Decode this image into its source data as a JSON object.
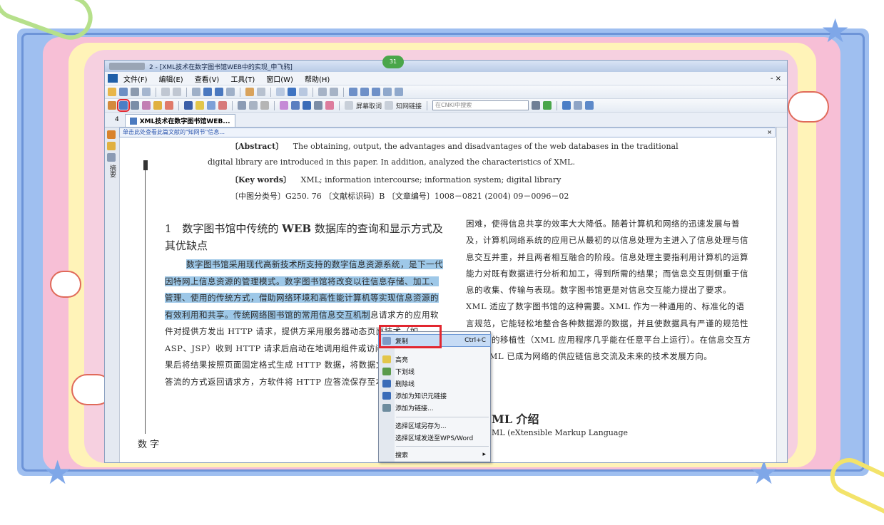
{
  "colors": {
    "highlight_red": "#e2262f",
    "selection_blue": "#9ec8e8",
    "frame_blue": "#9fbff0",
    "frame_pink": "#f7bfd6",
    "frame_yellow": "#fff3b8"
  },
  "window": {
    "title": "2 - [XML技术在数字图书馆WEB中的实现_申飞鸦]",
    "badge": "31"
  },
  "menubar": {
    "items": [
      "文件(F)",
      "编辑(E)",
      "查看(V)",
      "工具(T)",
      "窗口(W)",
      "帮助(H)"
    ],
    "window_controls": "- ×"
  },
  "toolbar2": {
    "icons": [
      "settings-icon",
      "text-select-icon",
      "snapshot-icon",
      "eraser-icon",
      "brush-icon",
      "mark-icon",
      "pen-icon",
      "highlight-pen-icon",
      "rect-icon",
      "circle-icon",
      "image-icon",
      "link-icon",
      "bookmark-icon",
      "underline-icon",
      "strike-icon",
      "anchor-icon",
      "stamp-icon",
      "heart-icon"
    ],
    "screen_translate": "屏幕取词",
    "knowledge_link": "知网链接",
    "search_placeholder": "在CNKI中搜索"
  },
  "tab": {
    "label": "XML技术在数字图书馆WEB...",
    "index": "4"
  },
  "infobar": {
    "text": "单击此处查看此篇文献的\"知网节\"信息...",
    "close": "×"
  },
  "leftrail": {
    "label": "摘要"
  },
  "doc": {
    "abstract_label": "〔Abstract〕",
    "abstract_line1": "The obtaining, output, the advantages and disadvantages of the web databases in the traditional",
    "abstract_line2": "digital library are introduced in this paper. In addition, analyzed the characteristics of XML.",
    "keywords_label": "〔Key words〕",
    "keywords_text": "XML; information intercourse; information system; digital library",
    "classification": "〔中图分类号〕G250. 76   〔文献标识码〕B   〔文章编号〕1008－0821 (2004) 09－0096－02",
    "heading_num": "1",
    "heading_pre": "数字图书馆中传统的",
    "heading_bold": "WEB",
    "heading_post": "数据库的查询和显示方式及其优缺点",
    "left_highlighted": "数字图书馆采用现代高新技术所支持的数字信息资源系统，是下一代因特网上信息资源的管理模式。数字图书馆将改变以往信息存储、加工、管理、使用的传统方式，借助网络环境和高性能计算机等实现信息资源的有效利用和共享。传统网络图书馆的常用信息交互机制",
    "left_rest": "息请求方的应用软件对提供方发出 HTTP 请求，提供方采用服务器动态页面技术（如 ASP、JSP）收到 HTTP 请求后启动在地调用组件或访问数据库，得到结果后将结果按照页面固定格式生成 HTTP 数据，将数据文件以 HTTP 应答流的方式返回请求方，方软件将 HTTP 应答流保存至本地系统。图表",
    "right_text": "困难，使得信息共享的效率大大降低。随着计算机和网络的迅速发展与普及，计算机网络系统的应用已从最初的以信息处理为主进入了信息处理与信息交互并重，并且两者相互融合的阶段。信息处理主要指利用计算机的运算能力对既有数据进行分析和加工，得到所需的结果；而信息交互则侧重于信息的收集、传输与表现。数字图书馆更是对信息交互能力提出了要求。XML 适应了数字图书馆的这种需要。XML 作为一种通用的、标准化的语言规范，它能轻松地整合各种数据源的数据，并且使数据具有严谨的规范性和良好的移植性（XML 应用程序几乎能在任意平台上运行）。在信息交互方面，XML 已成为网络的供应链信息交流及未来的技术发展方向。",
    "section2_title": "ML 介绍",
    "section2_text": "ML (eXtensible Markup Language",
    "fragment": "数 字"
  },
  "context_menu": {
    "items": [
      {
        "label": "复制",
        "shortcut": "Ctrl+C",
        "icon": "copy-icon"
      },
      {
        "label": "高亮",
        "icon": "highlight-icon"
      },
      {
        "label": "下划线",
        "icon": "underline-icon"
      },
      {
        "label": "删除线",
        "icon": "strikethrough-icon"
      },
      {
        "label": "添加为知识元链接",
        "icon": "knowledge-link-icon"
      },
      {
        "label": "添加为链接...",
        "icon": "add-link-icon"
      },
      {
        "label": "选择区域另存为...",
        "icon": ""
      },
      {
        "label": "选择区域发送至WPS/Word",
        "icon": ""
      },
      {
        "label": "搜索",
        "icon": "",
        "submenu": "▸"
      }
    ]
  }
}
